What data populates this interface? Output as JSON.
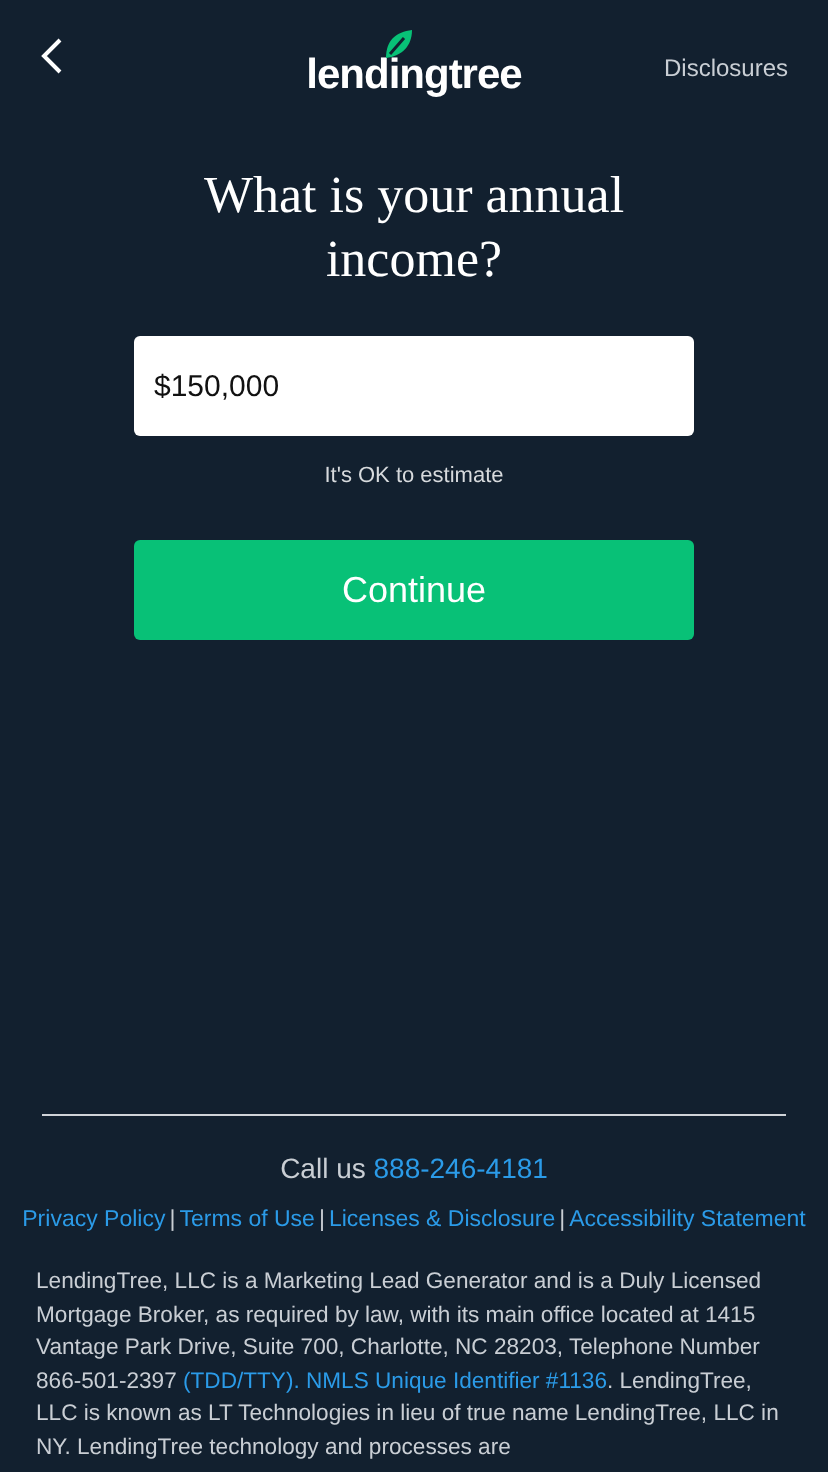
{
  "header": {
    "logo": "lendingtree",
    "disclosures_link": "Disclosures"
  },
  "question": "What is your annual income?",
  "income_field": {
    "value": "$150,000"
  },
  "hint": "It's OK to estimate",
  "continue_button": "Continue",
  "footer": {
    "call_label": "Call us",
    "phone": "888-246-4181",
    "links": [
      "Privacy Policy",
      "Terms of Use",
      "Licenses & Disclosure",
      "Accessibility Statement"
    ],
    "separator": "|",
    "disclaimer": {
      "before": "LendingTree, LLC is a Marketing Lead Generator and is a Duly Licensed Mortgage Broker, as required by law, with its main office located at 1415 Vantage Park Drive, Suite 700, Charlotte, NC 28203, Telephone Number 866-501-2397",
      "link": "(TDD/TTY). NMLS Unique Identifier #1136",
      "after": ". LendingTree, LLC is known as LT Technologies in lieu of true name LendingTree, LLC in NY. LendingTree technology and processes are"
    }
  }
}
